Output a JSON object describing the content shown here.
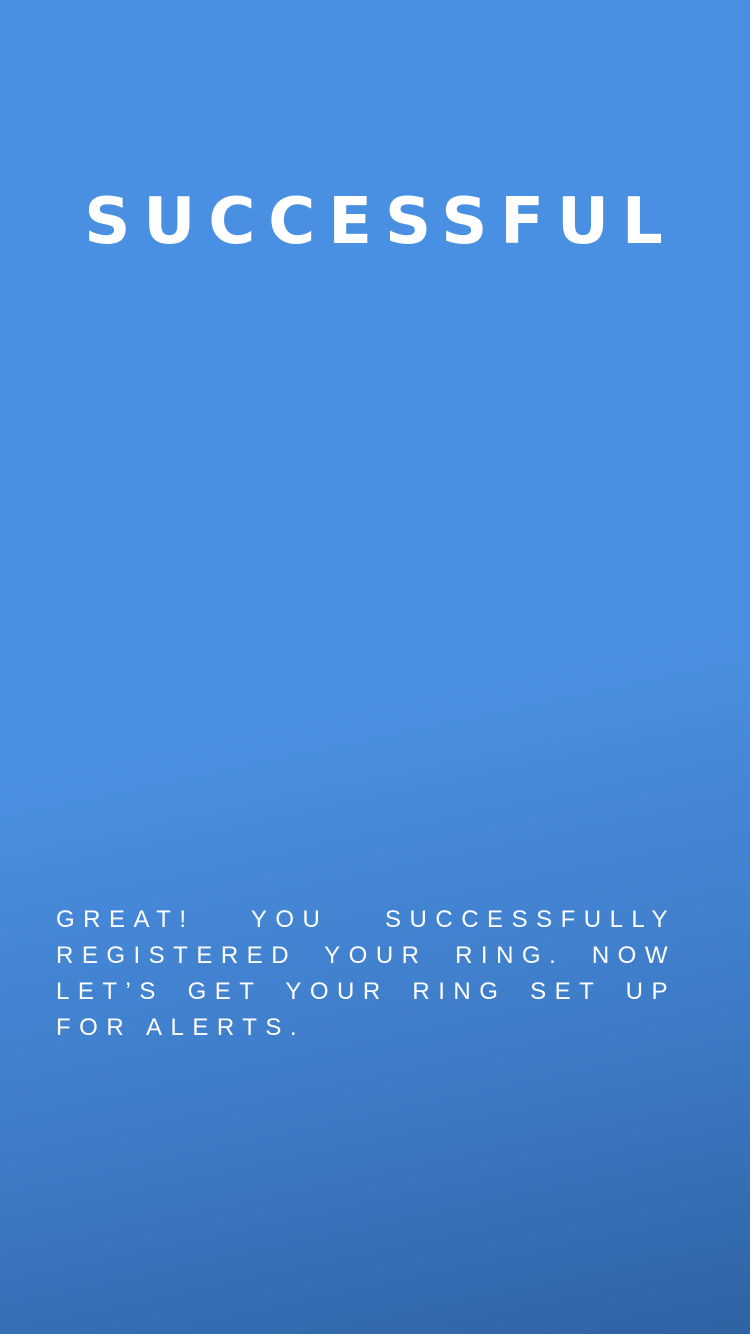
{
  "colors": {
    "background": "#4a90e2",
    "text": "#ffffff"
  },
  "screen": {
    "title": "SUCCESSFUL",
    "message": "GREAT! YOU SUCCESSFULLY REGISTERED YOUR RING. NOW LET’S GET YOUR RING SET UP FOR ALERTS."
  }
}
